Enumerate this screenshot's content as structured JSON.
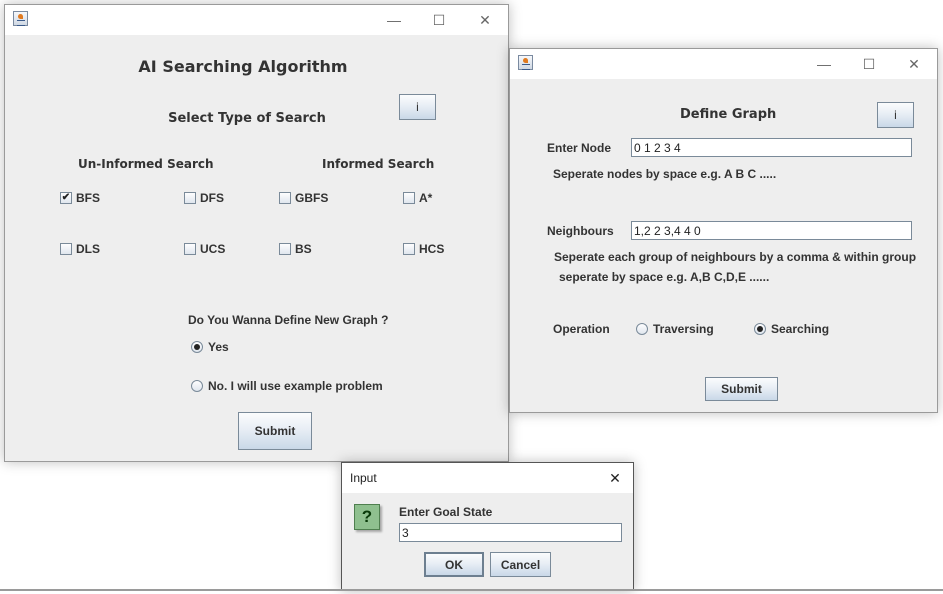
{
  "main_window": {
    "title_icon": "java-cup-icon",
    "controls": {
      "minimize": "—",
      "maximize": "☐",
      "close": "✕"
    },
    "heading": "AI Searching Algorithm",
    "subheading": "Select Type of Search",
    "info_button": "i",
    "uninformed": {
      "label": "Un-Informed Search",
      "options": [
        {
          "label": "BFS",
          "checked": true
        },
        {
          "label": "DFS",
          "checked": false
        },
        {
          "label": "DLS",
          "checked": false
        },
        {
          "label": "UCS",
          "checked": false
        }
      ]
    },
    "informed": {
      "label": "Informed Search",
      "options": [
        {
          "label": "GBFS",
          "checked": false
        },
        {
          "label": "A*",
          "checked": false
        },
        {
          "label": "BS",
          "checked": false
        },
        {
          "label": "HCS",
          "checked": false
        }
      ]
    },
    "question": "Do You Wanna Define New Graph ?",
    "radio_yes": {
      "label": "Yes",
      "selected": true
    },
    "radio_no": {
      "label": "No. I will use example problem",
      "selected": false
    },
    "submit": "Submit"
  },
  "graph_window": {
    "controls": {
      "minimize": "—",
      "maximize": "☐",
      "close": "✕"
    },
    "heading": "Define Graph",
    "info_button": "i",
    "node_label": "Enter Node",
    "node_value": "0 1 2 3 4",
    "node_hint": "Seperate nodes by space e.g. A B C .....",
    "neighbours_label": "Neighbours",
    "neighbours_value": "1,2 2 3,4 4 0",
    "neighbours_hint_1": "Seperate each group of neighbours by a comma & within group",
    "neighbours_hint_2": "seperate by space e.g. A,B C,D,E ......",
    "operation_label": "Operation",
    "op_traversing": {
      "label": "Traversing",
      "selected": false
    },
    "op_searching": {
      "label": "Searching",
      "selected": true
    },
    "submit": "Submit"
  },
  "input_dialog": {
    "title": "Input",
    "close": "✕",
    "question_icon": "?",
    "prompt": "Enter Goal State",
    "value": "3",
    "ok": "OK",
    "cancel": "Cancel"
  },
  "colors": {
    "panel": "#eeeeee",
    "button_border": "#7a8a99",
    "question_icon_bg": "#8fc08f"
  }
}
